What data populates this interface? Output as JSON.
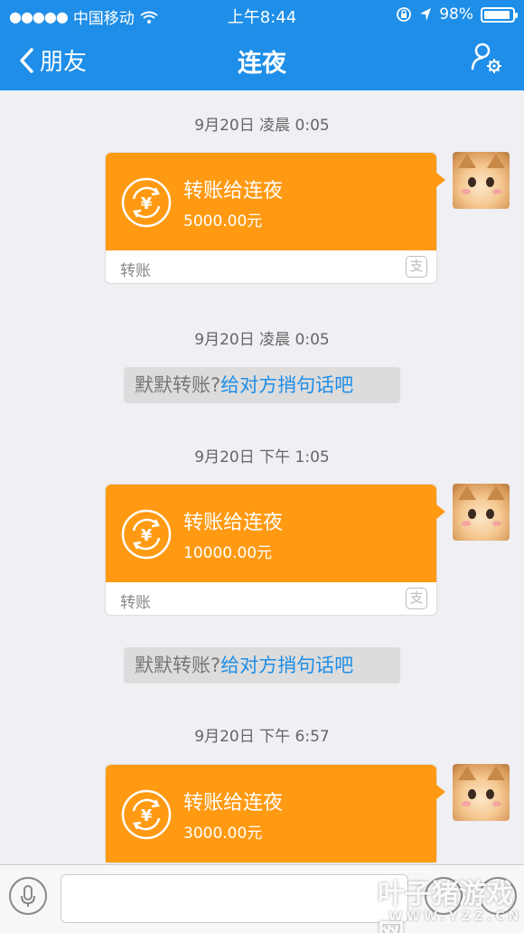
{
  "status_bar": {
    "carrier": "中国移动",
    "time": "上午8:44",
    "battery": "98%"
  },
  "nav": {
    "back_label": "朋友",
    "title": "连夜"
  },
  "messages": [
    {
      "timestamp": "9月20日 凌晨 0:05",
      "title": "转账给连夜",
      "amount": "5000.00元",
      "kind": "转账"
    },
    {
      "timestamp": "9月20日 凌晨 0:05",
      "hint_gray": "默默转账?",
      "hint_link": "给对方捎句话吧"
    },
    {
      "timestamp": "9月20日 下午 1:05",
      "title": "转账给连夜",
      "amount": "10000.00元",
      "kind": "转账"
    },
    {
      "hint_gray": "默默转账?",
      "hint_link": "给对方捎句话吧"
    },
    {
      "timestamp": "9月20日 下午 6:57",
      "title": "转账给连夜",
      "amount": "3000.00元"
    }
  ],
  "icons": {
    "back": "chevron-left-icon",
    "profile": "user-settings-icon",
    "coin": "yuan-transfer-icon",
    "alipay": "alipay-icon",
    "voice": "microphone-icon"
  },
  "colors": {
    "nav": "#1e8ee8",
    "card": "#ff9a12",
    "link": "#1e8ee8",
    "background": "#efeff4"
  },
  "input": {
    "placeholder": ""
  },
  "watermark": {
    "main": "叶子猪游戏网",
    "sub": "WWW.YZZ.CN"
  }
}
